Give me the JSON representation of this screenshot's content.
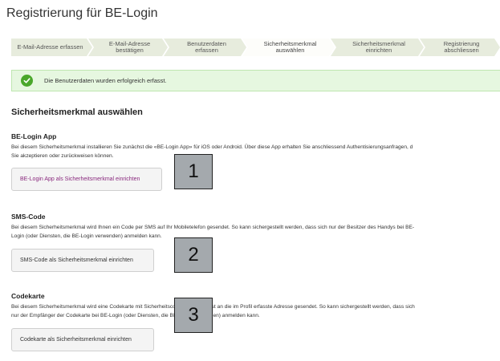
{
  "page": {
    "title": "Registrierung für BE-Login"
  },
  "steps": [
    {
      "label": "E-Mail-Adresse erfassen",
      "active": false
    },
    {
      "label": "E-Mail-Adresse bestätigen",
      "active": false
    },
    {
      "label": "Benutzerdaten erfassen",
      "active": false
    },
    {
      "label": "Sicherheitsmerkmal auswählen",
      "active": true
    },
    {
      "label": "Sicherheitsmerkmal einrichten",
      "active": false
    },
    {
      "label": "Registrierung abschliessen",
      "active": false
    }
  ],
  "success": {
    "message": "Die Benutzerdaten wurden erfolgreich erfasst.",
    "icon": "check-circle-icon",
    "color": "#4aa72b"
  },
  "main": {
    "heading": "Sicherheitsmerkmal auswählen",
    "sections": [
      {
        "title": "BE-Login App",
        "description_lines": [
          "Bei diesem Sicherheitsmerkmal installieren Sie zunächst die «BE-Login App» für iOS oder Android. Über diese App erhalten Sie anschliessend Authentisierungsanfragen, d",
          "Sie akzeptieren oder zurückweisen können."
        ],
        "button_label": "BE-Login App als Sicherheitsmerkmal einrichten"
      },
      {
        "title": "SMS-Code",
        "description_lines": [
          "Bei diesem Sicherheitsmerkmal wird Ihnen ein Code per SMS auf Ihr Mobiletelefon gesendet. So kann sichergestellt werden, dass sich nur der Besitzer des Handys bei BE-",
          "Login (oder Diensten, die BE-Login verwenden) anmelden kann."
        ],
        "button_label": "SMS-Code als Sicherheitsmerkmal einrichten"
      },
      {
        "title": "Codekarte",
        "description_lines": [
          "Bei diesem Sicherheitsmerkmal wird eine Codekarte mit Sicherheitscodes per Briefpost an die im Profil erfasste Adresse gesendet. So kann sichergestellt werden, dass sich",
          "nur der Empfänger der Codekarte bei BE-Login (oder Diensten, die BE-Login verwenden) anmelden kann."
        ],
        "button_label": "Codekarte als Sicherheitsmerkmal einrichten"
      }
    ]
  },
  "markers": [
    "1",
    "2",
    "3"
  ],
  "colors": {
    "step_bg": "#e7ecdd",
    "accent_purple": "#8a2a7e",
    "success_bg": "#e6f7e0"
  }
}
